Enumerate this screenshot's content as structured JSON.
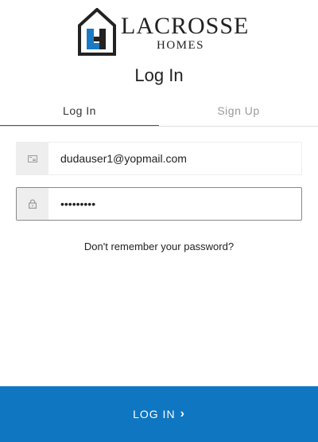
{
  "brand": {
    "name": "LACROSSE",
    "sub": "HOMES",
    "logo_icon": "house-lh-logo-icon"
  },
  "page": {
    "title": "Log In"
  },
  "tabs": [
    {
      "label": "Log In",
      "active": true
    },
    {
      "label": "Sign Up",
      "active": false
    }
  ],
  "form": {
    "email": {
      "value": "dudauser1@yopmail.com",
      "icon": "envelope-icon"
    },
    "password": {
      "value": "•••••••••",
      "icon": "lock-icon"
    },
    "forgot_label": "Don't remember your password?"
  },
  "submit": {
    "label": "LOG IN",
    "icon": "chevron-right-icon"
  },
  "colors": {
    "accent": "#0f76c2",
    "logo_blue": "#1c7ac4",
    "logo_dark": "#222222"
  }
}
